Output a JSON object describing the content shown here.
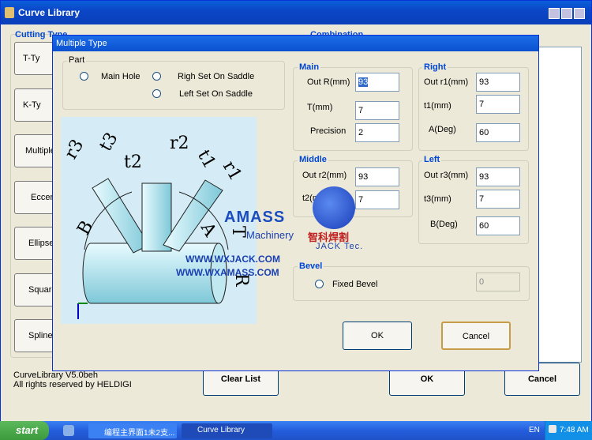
{
  "main_window": {
    "title": "Curve Library",
    "cutting_type_label": "Cutting Type",
    "combination_label": "Combination",
    "side_buttons": [
      "T-Ty",
      "K-Ty",
      "Multiple",
      "Eccen",
      "Ellipse",
      "Square",
      "Spline"
    ],
    "version_text": "CurveLibrary V5.0beh",
    "copyright_text": "All rights reserved by HELDIGI",
    "clear_list_label": "Clear List",
    "ok_label": "OK",
    "cancel_label": "Cancel"
  },
  "dialog": {
    "title": "Multiple Type",
    "part": {
      "label": "Part",
      "options": [
        "Main Hole",
        "Righ Set On Saddle",
        "Left Set On Saddle"
      ]
    },
    "main": {
      "label": "Main",
      "fields": [
        {
          "label": "Out R(mm)",
          "value": "93"
        },
        {
          "label": "T(mm)",
          "value": "7"
        },
        {
          "label": "Precision",
          "value": "2"
        }
      ]
    },
    "right": {
      "label": "Right",
      "fields": [
        {
          "label": "Out r1(mm)",
          "value": "93"
        },
        {
          "label": "t1(mm)",
          "value": "7"
        },
        {
          "label": "A(Deg)",
          "value": "60"
        }
      ]
    },
    "middle": {
      "label": "Middle",
      "fields": [
        {
          "label": "Out r2(mm)",
          "value": "93"
        },
        {
          "label": "t2(mm)",
          "value": "7"
        }
      ]
    },
    "left": {
      "label": "Left",
      "fields": [
        {
          "label": "Out r3(mm)",
          "value": "93"
        },
        {
          "label": "t3(mm)",
          "value": "7"
        },
        {
          "label": "B(Deg)",
          "value": "60"
        }
      ]
    },
    "bevel": {
      "label": "Bevel",
      "option": "Fixed Bevel",
      "value": "0"
    },
    "ok_label": "OK",
    "cancel_label": "Cancel",
    "diagram_labels": {
      "r3": "r3",
      "t3": "t3",
      "t2": "t2",
      "r2": "r2",
      "t1": "t1",
      "r1": "r1",
      "B": "B",
      "A": "A",
      "T": "T",
      "R": "R"
    }
  },
  "watermark": {
    "brand": "AMASS",
    "sub": "Machinery",
    "cn": "智科焊割",
    "jack": "JACK Tec.",
    "url1": "WWW.WXJACK.COM",
    "url2": "WWW.WXAMASS.COM"
  },
  "taskbar": {
    "start_label": "start",
    "tasks": [
      "编程主界面1未2支...",
      "Curve Library"
    ],
    "lang": "EN",
    "time": "7:48 AM"
  }
}
